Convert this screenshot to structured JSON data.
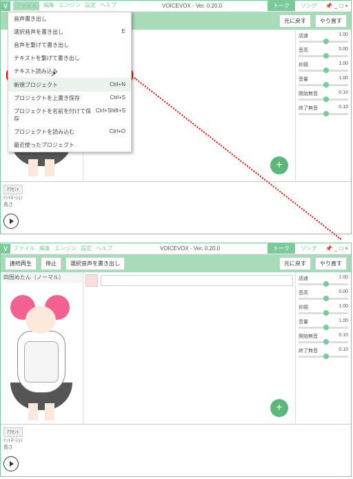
{
  "app": {
    "title": "VOICEVOX - Ver. 0.20.0"
  },
  "menubar": {
    "file": "ファイル",
    "edit": "編集",
    "engine": "エンジン",
    "settings": "設定",
    "help": "ヘルプ"
  },
  "modeTabs": {
    "talk": "トーク",
    "song": "ソング"
  },
  "winctl": {
    "pin": "📌",
    "min": "_",
    "max": "□",
    "close": "×"
  },
  "toolbar": {
    "continuous": "連続再生",
    "stop": "停止",
    "exportSelected": "選択音声を書き出し",
    "undo": "元に戻す",
    "redo": "やり直す"
  },
  "character": {
    "name": "四国めたん（ノーマル）"
  },
  "sliders": [
    {
      "label": "話速",
      "value": "1.00"
    },
    {
      "label": "音高",
      "value": "0.00"
    },
    {
      "label": "抑揚",
      "value": "1.00"
    },
    {
      "label": "音量",
      "value": "1.00"
    },
    {
      "label": "開始無音",
      "value": "0.10"
    },
    {
      "label": "終了無音",
      "value": "0.10"
    }
  ],
  "bottom": {
    "accent": "ｱｸｾﾝﾄ",
    "intonation": "ｲﾝﾄﾈｰｼｮﾝ",
    "length": "長さ"
  },
  "fileMenu": {
    "items": [
      {
        "label": "音声書き出し",
        "accel": ""
      },
      {
        "label": "選択音声を書き出し",
        "accel": "E"
      },
      {
        "label": "音声を繋げて書き出し",
        "accel": ""
      },
      {
        "label": "テキストを繋げて書き出し",
        "accel": ""
      },
      {
        "label": "テキスト読み込み",
        "accel": ""
      },
      {
        "label": "新規プロジェクト",
        "accel": "Ctrl+N",
        "highlight": true
      },
      {
        "label": "プロジェクトを上書き保存",
        "accel": "Ctrl+S"
      },
      {
        "label": "プロジェクトを名前を付けて保存",
        "accel": "Ctrl+Shift+S"
      },
      {
        "label": "プロジェクトを読み込む",
        "accel": "Ctrl+O"
      },
      {
        "label": "最近使ったプロジェクト",
        "accel": ""
      }
    ]
  },
  "addBtn": "+"
}
